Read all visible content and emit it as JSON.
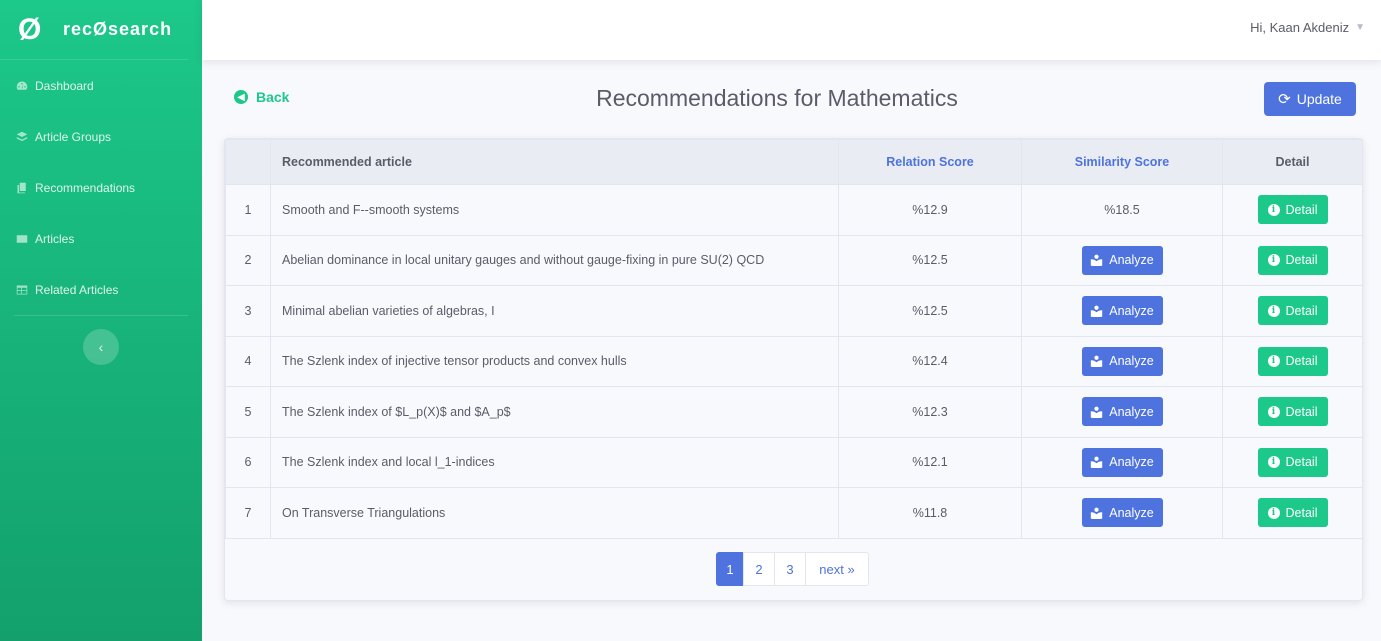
{
  "brand": {
    "logo": "Ø",
    "name": "recØsearch"
  },
  "sidebar": {
    "items": [
      {
        "label": "Dashboard",
        "icon": "tachometer-icon"
      },
      {
        "label": "Article Groups",
        "icon": "layers-icon"
      },
      {
        "label": "Recommendations",
        "icon": "copy-icon"
      },
      {
        "label": "Articles",
        "icon": "list-icon"
      },
      {
        "label": "Related Articles",
        "icon": "table-icon"
      }
    ],
    "toggle": "‹"
  },
  "topbar": {
    "user": "Hi, Kaan Akdeniz"
  },
  "header": {
    "back_label": "Back",
    "title": "Recommendations for Mathematics",
    "update_label": "Update"
  },
  "table": {
    "columns": [
      "",
      "Recommended article",
      "Relation Score",
      "Similarity Score",
      "Detail"
    ],
    "analyze_label": "Analyze",
    "detail_label": "Detail",
    "rows": [
      {
        "idx": "1",
        "title": "Smooth and F--smooth systems",
        "relation": "%12.9",
        "similarity": "%18.5"
      },
      {
        "idx": "2",
        "title": "Abelian dominance in local unitary gauges and without gauge-fixing in pure SU(2) QCD",
        "relation": "%12.5",
        "similarity": null
      },
      {
        "idx": "3",
        "title": "Minimal abelian varieties of algebras, I",
        "relation": "%12.5",
        "similarity": null
      },
      {
        "idx": "4",
        "title": "The Szlenk index of injective tensor products and convex hulls",
        "relation": "%12.4",
        "similarity": null
      },
      {
        "idx": "5",
        "title": "The Szlenk index of $L_p(X)$ and $A_p$",
        "relation": "%12.3",
        "similarity": null
      },
      {
        "idx": "6",
        "title": "The Szlenk index and local l_1-indices",
        "relation": "%12.1",
        "similarity": null
      },
      {
        "idx": "7",
        "title": "On Transverse Triangulations",
        "relation": "%11.8",
        "similarity": null
      }
    ]
  },
  "pagination": {
    "pages": [
      "1",
      "2",
      "3"
    ],
    "next": "next »",
    "active": "1"
  },
  "colors": {
    "primary": "#4e73df",
    "success": "#1cc88a",
    "text": "#5a5c69"
  }
}
